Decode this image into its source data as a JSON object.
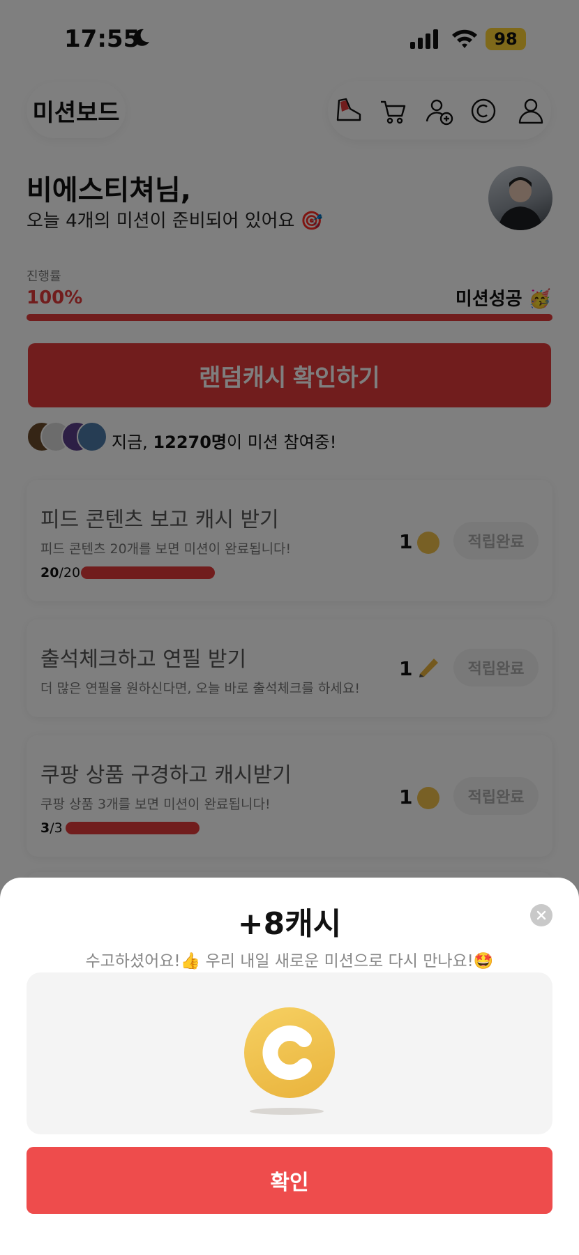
{
  "status_bar": {
    "time": "17:55",
    "battery": "98"
  },
  "header": {
    "title": "미션보드"
  },
  "greeting": {
    "name": "비에스티쳐님,",
    "subtitle": "오늘 4개의 미션이 준비되어 있어요 🎯"
  },
  "progress": {
    "label": "진행률",
    "percent_text": "100%",
    "status": "미션성공 🥳",
    "value": 1.0
  },
  "random_cash_button": "랜덤캐시 확인하기",
  "participants": {
    "prefix": "지금, ",
    "count": "12270명",
    "suffix": "이 미션 참여중!"
  },
  "missions": [
    {
      "title": "피드 콘텐츠 보고 캐시 받기",
      "desc": "피드 콘텐츠 20개를 보면 미션이 완료됩니다!",
      "done": "20",
      "total": "/20",
      "reward": "1",
      "reward_icon": "coin-icon",
      "status": "적립완료"
    },
    {
      "title": "출석체크하고 연필 받기",
      "desc": "더 많은 연필을 원하신다면, 오늘 바로 출석체크를 하세요!",
      "reward": "1",
      "reward_icon": "pencil-icon",
      "status": "적립완료"
    },
    {
      "title": "쿠팡 상품 구경하고 캐시받기",
      "desc": "쿠팡 상품 3개를 보면 미션이 완료됩니다!",
      "done": "3",
      "total": "/3",
      "reward": "1",
      "reward_icon": "coin-icon",
      "status": "적립완료"
    }
  ],
  "sheet": {
    "title": "+8캐시",
    "subtitle": "수고하셨어요!👍 우리 내일 새로운 미션으로 다시 만나요!🤩",
    "confirm": "확인"
  },
  "colors": {
    "accent": "#e23a3a",
    "coin": "#f1c14a",
    "battery": "#ffd234",
    "confirm": "#ee4c4c"
  }
}
